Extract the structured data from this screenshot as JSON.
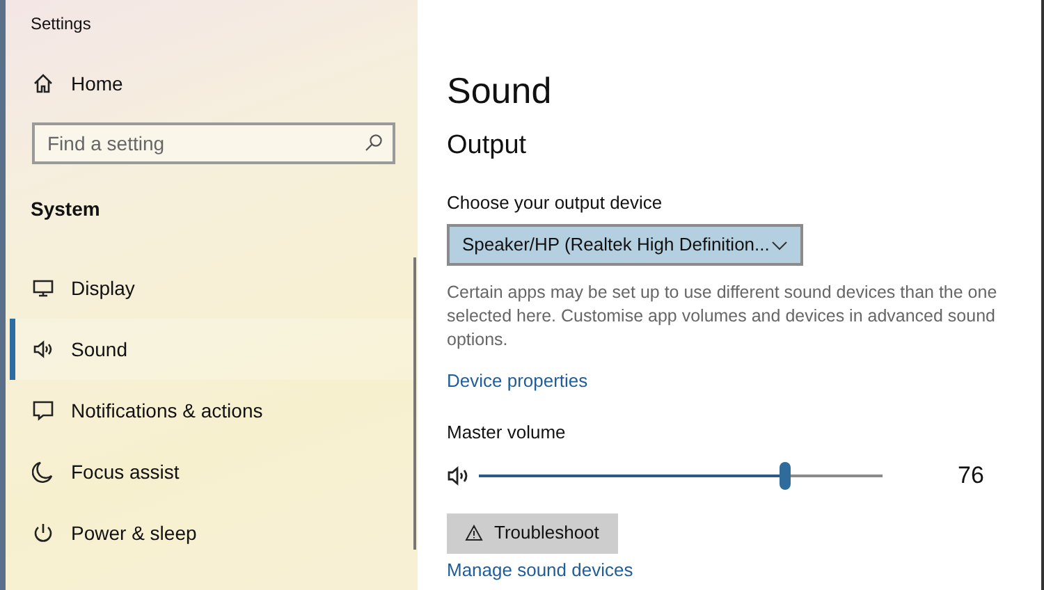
{
  "window": {
    "title": "Settings"
  },
  "sidebar": {
    "home": "Home",
    "search": {
      "placeholder": "Find a setting"
    },
    "section": "System",
    "items": [
      {
        "kind": "display",
        "label": "Display",
        "selected": false
      },
      {
        "kind": "sound",
        "label": "Sound",
        "selected": true
      },
      {
        "kind": "notifications",
        "label": "Notifications & actions",
        "selected": false
      },
      {
        "kind": "focus",
        "label": "Focus assist",
        "selected": false
      },
      {
        "kind": "power",
        "label": "Power & sleep",
        "selected": false
      }
    ]
  },
  "page": {
    "title": "Sound",
    "section": "Output",
    "device_label": "Choose your output device",
    "device": "Speaker/HP (Realtek High Definition...",
    "note": "Certain apps may be set up to use different sound devices than the one selected here. Customise app volumes and devices in advanced sound options.",
    "device_link": "Device properties",
    "volume": {
      "label": "Master volume",
      "level": 0.76,
      "reading": "76"
    },
    "troubleshoot": "Troubleshoot",
    "manage_link": "Manage sound devices"
  }
}
